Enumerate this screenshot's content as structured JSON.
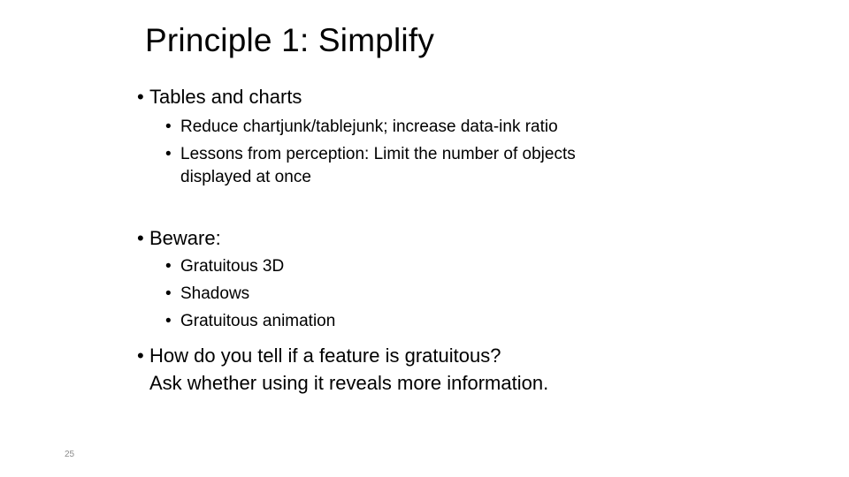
{
  "slide": {
    "title": "Principle 1: Simplify",
    "bullet_glyph": "•",
    "sections": [
      {
        "text": "Tables and charts",
        "items": [
          "Reduce chartjunk/tablejunk; increase data-ink ratio",
          "Lessons from perception: Limit the number of objects",
          "displayed at once"
        ]
      },
      {
        "text": "Beware:",
        "items": [
          "Gratuitous 3D",
          "Shadows",
          "Gratuitous animation"
        ]
      },
      {
        "text": "How do you tell if a feature is gratuitous?",
        "continuation": "Ask whether using it reveals more information."
      }
    ],
    "slide_number": "25"
  }
}
